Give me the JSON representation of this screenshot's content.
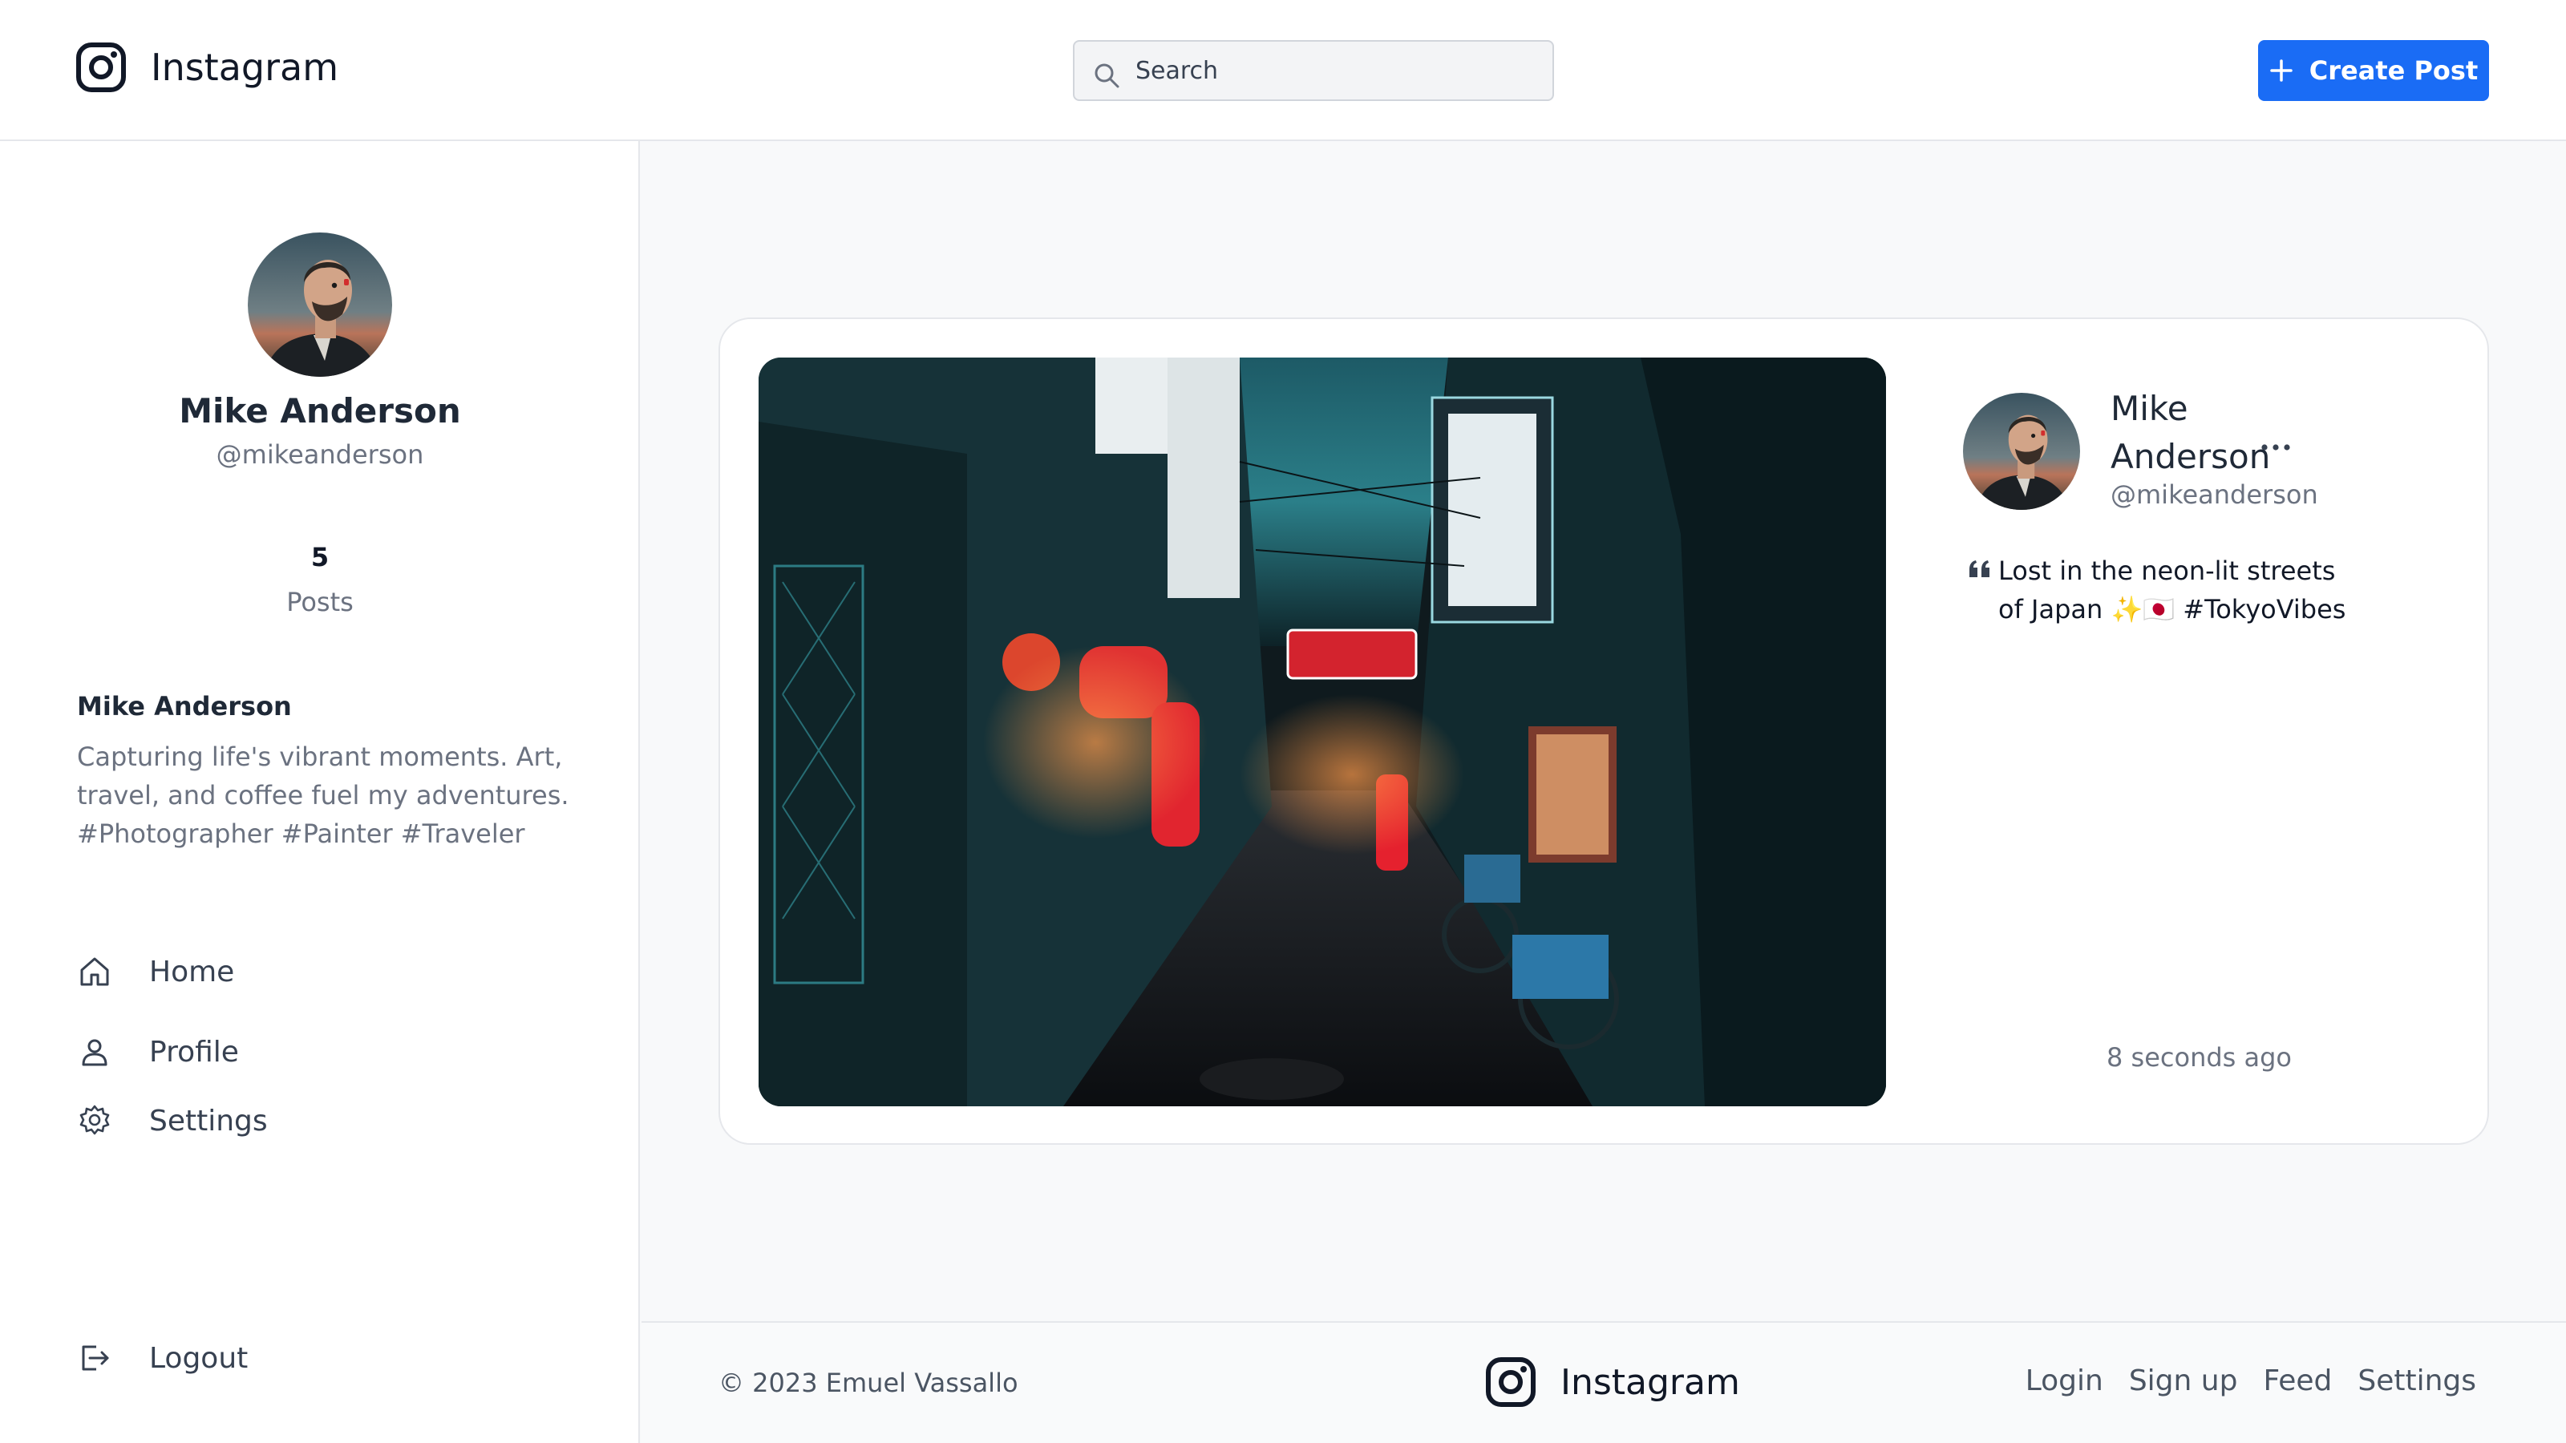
{
  "header": {
    "brand": "Instagram",
    "search_placeholder": "Search",
    "create_button": "Create Post"
  },
  "sidebar": {
    "name": "Mike Anderson",
    "handle": "@mikeanderson",
    "post_count": "5",
    "post_count_label": "Posts",
    "bio_name": "Mike Anderson",
    "bio_text": "Capturing life's vibrant moments. Art, travel, and coffee fuel my adventures. #Photographer #Painter #Traveler",
    "nav": [
      {
        "label": "Home",
        "icon": "home-icon"
      },
      {
        "label": "Profile",
        "icon": "user-icon"
      },
      {
        "label": "Settings",
        "icon": "gear-icon"
      }
    ],
    "logout": {
      "label": "Logout",
      "icon": "logout-icon"
    }
  },
  "post": {
    "author_name": "Mike Anderson",
    "author_handle": "@mikeanderson",
    "caption": "Lost in the neon-lit streets of Japan ✨🇯🇵 #TokyoVibes",
    "timestamp": "8 seconds ago"
  },
  "footer": {
    "copyright": "© 2023 Emuel Vassallo",
    "brand": "Instagram",
    "links": [
      "Login",
      "Sign up",
      "Feed",
      "Settings"
    ]
  },
  "colors": {
    "accent": "#1a6cf5",
    "background": "#f8f9fa",
    "muted_text": "#6b7280"
  }
}
